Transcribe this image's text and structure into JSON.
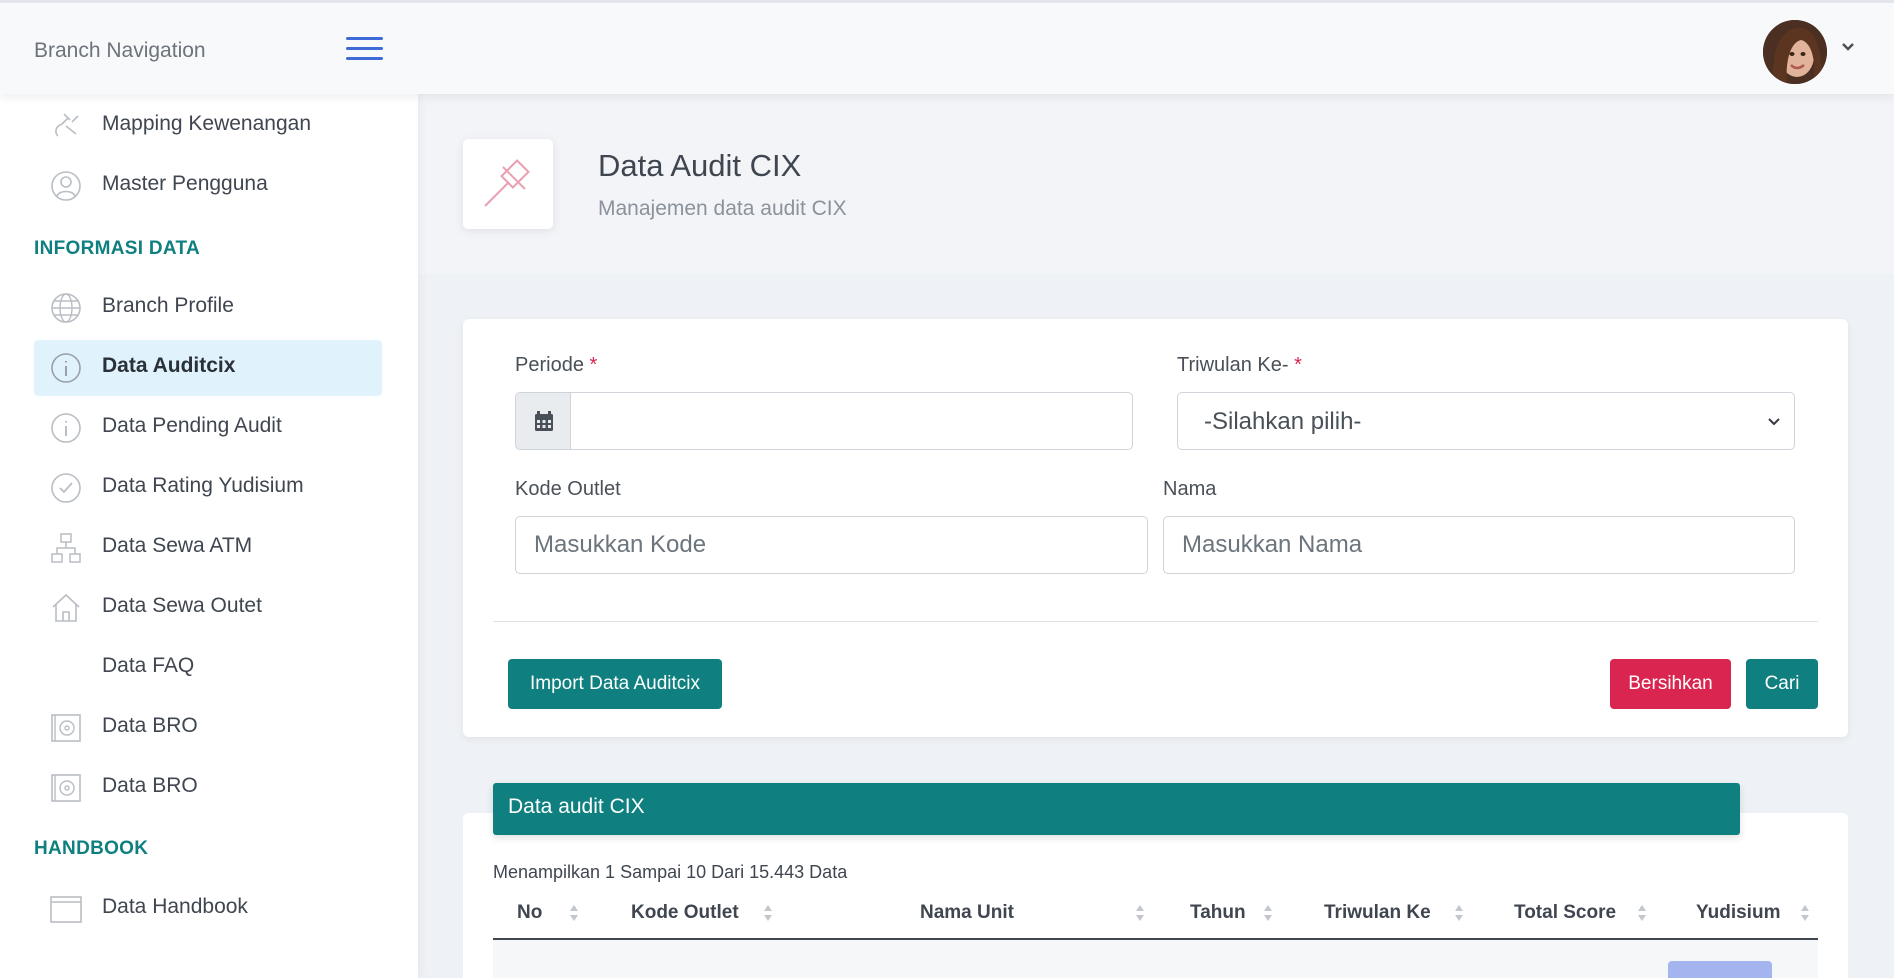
{
  "header": {
    "brand": "Branch Navigation",
    "menu_icon": "hamburger-icon",
    "avatar_icon": "user-avatar",
    "dropdown_icon": "chevron-down-icon"
  },
  "sidebar": {
    "items": [
      {
        "label": "Mapping Kewenangan",
        "icon": "plug-icon"
      },
      {
        "label": "Master Pengguna",
        "icon": "user-icon"
      }
    ],
    "section_informasi": "INFORMASI DATA",
    "informasi_items": [
      {
        "label": "Branch Profile",
        "icon": "globe-icon"
      },
      {
        "label": "Data Auditcix",
        "icon": "info-icon",
        "active": true
      },
      {
        "label": "Data Pending Audit",
        "icon": "info-icon"
      },
      {
        "label": "Data Rating Yudisium",
        "icon": "check-circle-icon"
      },
      {
        "label": "Data Sewa ATM",
        "icon": "network-icon"
      },
      {
        "label": "Data Sewa Outet",
        "icon": "home-icon"
      },
      {
        "label": "Data FAQ",
        "icon": ""
      },
      {
        "label": "Data BRO",
        "icon": "safe-icon"
      },
      {
        "label": "Data BRO",
        "icon": "safe-icon"
      }
    ],
    "section_handbook": "HANDBOOK",
    "handbook_items": [
      {
        "label": "Data Handbook",
        "icon": "folder-icon"
      }
    ]
  },
  "page": {
    "title": "Data Audit CIX",
    "subtitle": "Manajemen data audit CIX",
    "icon": "gavel-icon"
  },
  "filter": {
    "periode_label": "Periode",
    "required_mark": "*",
    "periode_value": "",
    "calendar_icon": "calendar-icon",
    "triwulan_label": "Triwulan Ke-",
    "triwulan_selected": "-Silahkan pilih-",
    "kode_label": "Kode Outlet",
    "kode_placeholder": "Masukkan Kode",
    "nama_label": "Nama",
    "nama_placeholder": "Masukkan Nama",
    "import_button": "Import Data Auditcix",
    "clear_button": "Bersihkan",
    "search_button": "Cari"
  },
  "table": {
    "banner": "Data audit CIX",
    "info": "Menampilkan 1 Sampai 10 Dari 15.443 Data",
    "columns": [
      "No",
      "Kode Outlet",
      "Nama Unit",
      "Tahun",
      "Triwulan Ke",
      "Total Score",
      "Yudisium"
    ]
  },
  "colors": {
    "primary_teal": "#0f7f7f",
    "danger": "#d92550",
    "accent_blue": "#3f6ad8",
    "active_nav_bg": "#e0f2fc"
  }
}
